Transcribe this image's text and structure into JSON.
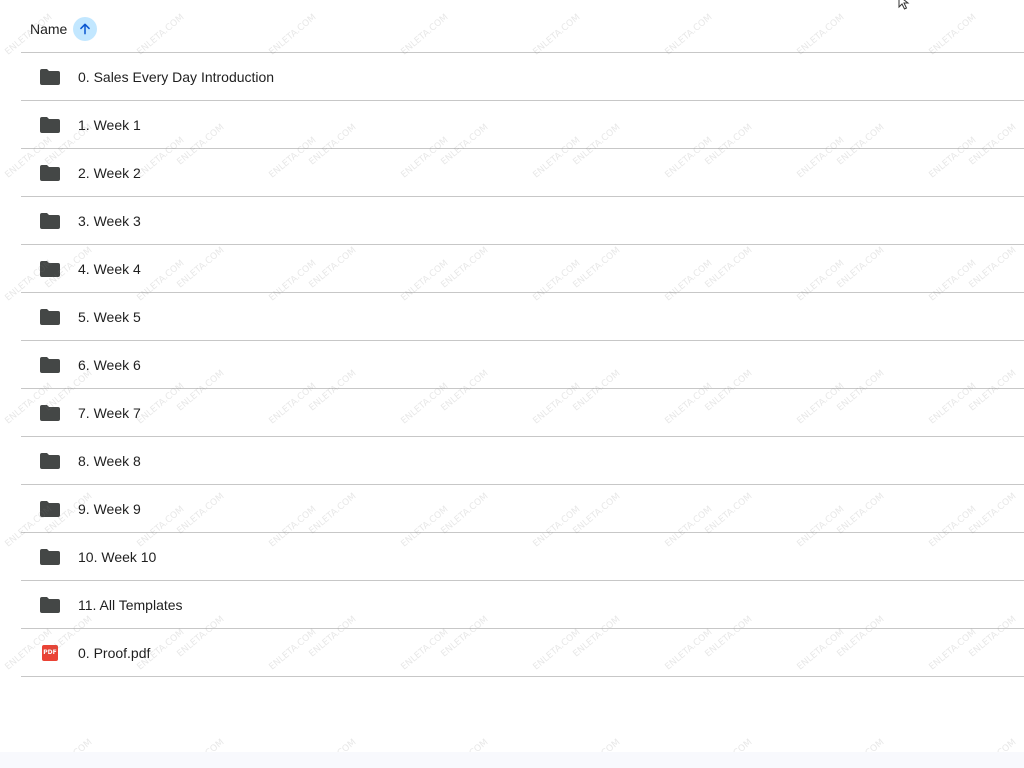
{
  "header": {
    "sort_column_label": "Name",
    "sort_direction_icon": "arrow-up-icon"
  },
  "files": [
    {
      "name": "0. Sales Every Day Introduction",
      "type": "folder",
      "icon": "folder-icon"
    },
    {
      "name": "1. Week 1",
      "type": "folder",
      "icon": "folder-icon"
    },
    {
      "name": "2. Week 2",
      "type": "folder",
      "icon": "folder-icon"
    },
    {
      "name": "3. Week 3",
      "type": "folder",
      "icon": "folder-icon"
    },
    {
      "name": "4. Week 4",
      "type": "folder",
      "icon": "folder-icon"
    },
    {
      "name": "5. Week 5",
      "type": "folder",
      "icon": "folder-icon"
    },
    {
      "name": "6. Week 6",
      "type": "folder",
      "icon": "folder-icon"
    },
    {
      "name": "7. Week 7",
      "type": "folder",
      "icon": "folder-icon"
    },
    {
      "name": "8. Week 8",
      "type": "folder",
      "icon": "folder-icon"
    },
    {
      "name": "9. Week 9",
      "type": "folder",
      "icon": "folder-icon"
    },
    {
      "name": "10. Week 10",
      "type": "folder",
      "icon": "folder-icon"
    },
    {
      "name": "11. All Templates",
      "type": "folder",
      "icon": "folder-icon"
    },
    {
      "name": "0. Proof.pdf",
      "type": "pdf",
      "icon": "pdf-icon",
      "badge": "PDF"
    }
  ],
  "watermark_text": "ENLETA.COM",
  "colors": {
    "sort_button_bg": "#c2e7ff",
    "sort_arrow": "#0b57d0",
    "folder": "#444746",
    "pdf": "#ea4335",
    "divider": "#c7c7c7"
  }
}
